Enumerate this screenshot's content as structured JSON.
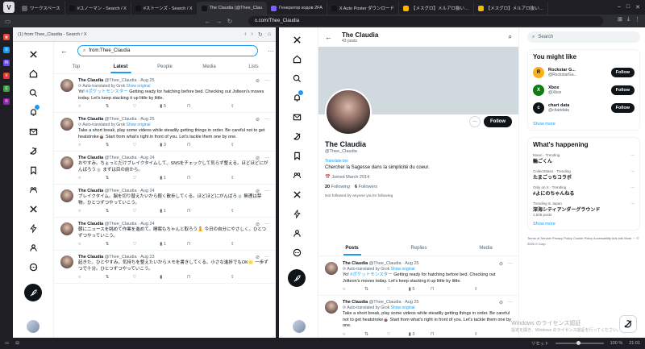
{
  "browser": {
    "tabs": [
      {
        "label": "ワークスペース",
        "color": "#5f6368"
      },
      {
        "label": "#ユノーマン - Search / X",
        "color": "#0f1419"
      },
      {
        "label": "#ストーンズ - Search / X",
        "color": "#0f1419"
      },
      {
        "label": "The Claudia (@Thee_Clau",
        "color": "#0f1419"
      },
      {
        "label": "Генератор кодов 2FA",
        "color": "#7b61ff"
      },
      {
        "label": "X Auto Poster ダウンロード",
        "color": "#0f1419"
      },
      {
        "label": "【メスグロ】メルアロ抜い…",
        "color": "#f5b800"
      },
      {
        "label": "【メスグロ】メルアロ抜い…",
        "color": "#f5b800"
      }
    ],
    "url": "x.com/Thee_Claudia",
    "left_pane_title": "(1) from:Thee_Claudia - Search / X",
    "status": {
      "zoom": "100 %",
      "time": "21:01"
    }
  },
  "left": {
    "search_value": "from:Thee_Claudia",
    "tabs": [
      "Top",
      "Latest",
      "People",
      "Media",
      "Lists"
    ],
    "active_tab": "Latest",
    "tweets": [
      {
        "name": "The Claudia",
        "handle": "@Thee_Claudia",
        "date": "· Aug 25",
        "translated": "Auto-translated by Grok",
        "show": "Show original",
        "text_pre": "Yo! ",
        "link": "#ポケットモンスター",
        "text": " Getting ready for hatching before bed. Checking out Jolteon's moves today. Let's keep stacking it up little by little.",
        "replies": "",
        "retweets": "",
        "likes": "",
        "views": "5"
      },
      {
        "name": "The Claudia",
        "handle": "@Thee_Claudia",
        "date": "· Aug 25",
        "translated": "Auto-translated by Grok",
        "show": "Show original",
        "text_pre": "",
        "link": "",
        "text": "Take a short break, play some videos while steadily getting things in order. Be careful not to get heatstroke🧉 Start from what's right in front of you. Let's tackle them one by one.",
        "replies": "",
        "retweets": "",
        "likes": "",
        "views": "3"
      },
      {
        "name": "The Claudia",
        "handle": "@Thee_Claudia",
        "date": "· Aug 24",
        "translated": "",
        "show": "",
        "text_pre": "",
        "link": "",
        "text": "おやすみ。ちょっとだけブレイクタイムして、SNSをチェックして気らず整える。ほどほどにがんばろう🍵 まずは目の前から。",
        "replies": "",
        "retweets": "",
        "likes": "",
        "views": "1"
      },
      {
        "name": "The Claudia",
        "handle": "@Thee_Claudia",
        "date": "· Aug 24",
        "translated": "",
        "show": "",
        "text_pre": "",
        "link": "",
        "text": "ブレイクタイム。脳を切り替えたいから軽く散歩してくる。ほどほどにがんばろ🍵 無理は禁物。ひとつずつやっていこう。",
        "replies": "",
        "retweets": "",
        "likes": "",
        "views": "1"
      },
      {
        "name": "The Claudia",
        "handle": "@Thee_Claudia",
        "date": "· Aug 24",
        "translated": "",
        "show": "",
        "text_pre": "",
        "link": "",
        "text": "朝にニュースを眺めて作業を進めて。睡眠もちゃんと取ろう🧘 今日の自分にやさしく。ひとつずつやっていこう。",
        "replies": "",
        "retweets": "",
        "likes": "",
        "views": "1"
      },
      {
        "name": "The Claudia",
        "handle": "@Thee_Claudia",
        "date": "· Aug 23",
        "translated": "",
        "show": "",
        "text_pre": "",
        "link": "",
        "text": "起きた。ひとやすみ。気持ちを整えたいからメモを書きしてくる。小さな進捗でもOK🌟 一歩ずつで十分。ひとつずつやっていこう。",
        "replies": "",
        "retweets": "",
        "likes": "",
        "views": ""
      }
    ]
  },
  "profile": {
    "name": "The Claudia",
    "posts_count": "43 posts",
    "handle": "@Thee_Claudia",
    "translate": "Translate bio",
    "bio": "Chercher la Sagesse dans la simplicité du coeur.",
    "joined": "Joined March 2014",
    "following_num": "20",
    "following_label": "Following",
    "followers_num": "6",
    "followers_label": "Followers",
    "not_followed": "Not followed by anyone you're following",
    "follow_label": "Follow",
    "tabs": [
      "Posts",
      "Replies",
      "Media"
    ],
    "tweets": [
      {
        "name": "The Claudia",
        "handle": "@Thee_Claudia",
        "date": "· Aug 25",
        "translated": "Auto-translated by Grok",
        "show": "Show original",
        "text_pre": "Yo! ",
        "link": "#ポケットモンスター",
        "text": " Getting ready for hatching before bed. Checking out Jolteon's moves today. Let's keep stacking it up little by little.",
        "views": "5"
      },
      {
        "name": "The Claudia",
        "handle": "@Thee_Claudia",
        "date": "· Aug 25",
        "translated": "Auto-translated by Grok",
        "show": "Show original",
        "text_pre": "",
        "link": "",
        "text": "Take a short break, play some videos while steadily getting things in order. Be careful not to get heatstroke🧉 Start from what's right in front of you. Let's tackle them one by one.",
        "views": "3"
      }
    ]
  },
  "widgets": {
    "search_placeholder": "Search",
    "you_might_like": "You might like",
    "suggestions": [
      {
        "name": "Rockstar G...",
        "handle": "@RockstarGa...",
        "initial": "R",
        "bg": "#fcaf17",
        "fg": "#000000"
      },
      {
        "name": "Xbox",
        "handle": "@Xbox",
        "initial": "X",
        "bg": "#107c10",
        "fg": "#ffffff"
      },
      {
        "name": "chart data",
        "handle": "@chartdata",
        "initial": "c",
        "bg": "#0f1419",
        "fg": "#ffffff"
      }
    ],
    "follow_label": "Follow",
    "show_more": "Show more",
    "whats_happening": "What's happening",
    "trends": [
      {
        "meta": "Music · Trending",
        "name": "輪ごくん",
        "posts": ""
      },
      {
        "meta": "CollectStaso · Trending",
        "name": "たまごっちコラボ",
        "posts": ""
      },
      {
        "meta": "Only on X · Trending",
        "name": "#よにのちゃんねる",
        "posts": ""
      },
      {
        "meta": "Trending in Japan",
        "name": "深海シティアンダーグラウンド",
        "posts": "1,648 posts"
      }
    ],
    "footer": "Terms of Service  Privacy Policy  Cookie Policy  Accessibility  Ads info  More ···  © 2025 X Corp.",
    "watermark_title": "Windows のライセンス認証",
    "watermark_sub": "設定を開き、Windows のライセンス認証を行ってください。"
  }
}
